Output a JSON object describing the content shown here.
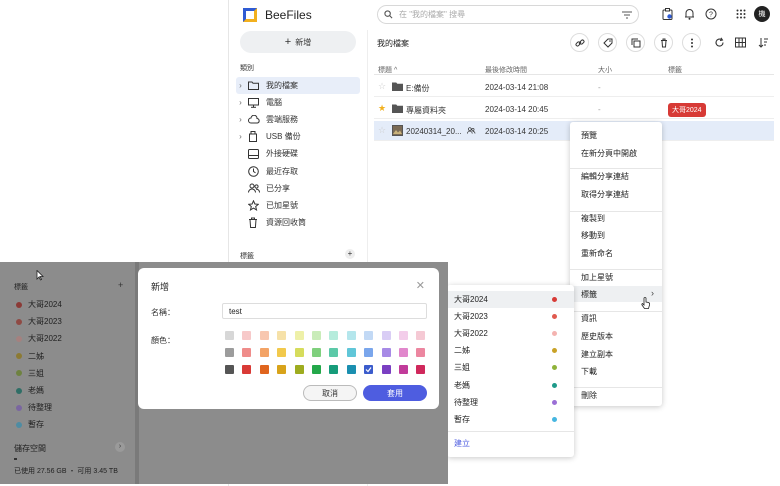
{
  "app": {
    "name": "BeeFiles",
    "search_placeholder": "在 \"我的檔案\" 搜尋",
    "avatar": "機",
    "new_button": "新增",
    "sidebar_heading": "類別",
    "sidebar": [
      {
        "label": "我的檔案",
        "icon": "folder-icon",
        "caret": true,
        "active": true
      },
      {
        "label": "電腦",
        "icon": "computer-icon",
        "caret": true,
        "active": false
      },
      {
        "label": "雲端服務",
        "icon": "cloud-icon",
        "caret": true,
        "active": false
      },
      {
        "label": "USB 備份",
        "icon": "usb-icon",
        "caret": true,
        "active": false
      },
      {
        "label": "外接硬碟",
        "icon": "drive-icon",
        "caret": false,
        "active": false
      },
      {
        "label": "最近存取",
        "icon": "clock-icon",
        "caret": false,
        "active": false
      },
      {
        "label": "已分享",
        "icon": "shared-icon",
        "caret": false,
        "active": false
      },
      {
        "label": "已加星號",
        "icon": "star-icon",
        "caret": false,
        "active": false
      },
      {
        "label": "資源回收筒",
        "icon": "trash-icon",
        "caret": false,
        "active": false
      }
    ],
    "tags_heading": "標籤",
    "main_title": "我的檔案",
    "columns": {
      "title": "標題 ^",
      "modified": "最後修改時間",
      "size": "大小",
      "tags": "標籤"
    },
    "files": [
      {
        "name": "E:備份",
        "modified": "2024-03-14 21:08",
        "size": "-",
        "starred": false,
        "type": "folder-icon",
        "tag": ""
      },
      {
        "name": "專屬資料夾",
        "modified": "2024-03-14 20:45",
        "size": "-",
        "starred": true,
        "type": "folder-icon",
        "tag": "大哥2024"
      },
      {
        "name": "20240314_20...",
        "modified": "2024-03-14 20:25",
        "size": "",
        "starred": false,
        "type": "image-icon",
        "tag": ""
      }
    ],
    "tag_color": "#d73a36"
  },
  "context_menu": {
    "items": [
      "預覽",
      "在新分頁中開啟",
      "編輯分享連結",
      "取得分享連結",
      "複製到",
      "移動到",
      "重新命名",
      "加上星號",
      "標籤",
      "資訊",
      "歷史版本",
      "建立副本",
      "下載",
      "刪除"
    ]
  },
  "tag_submenu": {
    "items": [
      {
        "label": "大哥2024",
        "color": "#d73a36"
      },
      {
        "label": "大哥2023",
        "color": "#e05a4f"
      },
      {
        "label": "大哥2022",
        "color": "#f4b3b0"
      },
      {
        "label": "二姊",
        "color": "#c9a227"
      },
      {
        "label": "三姐",
        "color": "#8fb33a"
      },
      {
        "label": "老媽",
        "color": "#1e9a8a"
      },
      {
        "label": "待整理",
        "color": "#9b6fd6"
      },
      {
        "label": "暫存",
        "color": "#46b6e0"
      }
    ],
    "create": "建立"
  },
  "bg_window": {
    "tags_heading": "標籤",
    "tags": [
      {
        "label": "大哥2024",
        "color": "#8b3a36"
      },
      {
        "label": "大哥2023",
        "color": "#8f4a44"
      },
      {
        "label": "大哥2022",
        "color": "#a5817f"
      },
      {
        "label": "二姊",
        "color": "#8c7a33"
      },
      {
        "label": "三姐",
        "color": "#6e8240"
      },
      {
        "label": "老媽",
        "color": "#2f6e66"
      },
      {
        "label": "待整理",
        "color": "#7a66a0"
      },
      {
        "label": "暫存",
        "color": "#4f8ca3"
      }
    ],
    "storage_heading": "儲存空間",
    "storage_text": "已使用 27.56 GB ・ 可用 3.45 TB"
  },
  "dialog": {
    "title": "新增",
    "name_label": "名稱：",
    "name_value": "test",
    "color_label": "顏色：",
    "cancel": "取消",
    "apply": "套用",
    "palette": [
      [
        "#d7d7d7",
        "#f7c9c9",
        "#f8c7b0",
        "#f6e1a8",
        "#eef0a8",
        "#c9ecb9",
        "#b6ecdc",
        "#b4e6ec",
        "#c2d9f5",
        "#d9cdf5",
        "#f3cdea",
        "#f5c9d4"
      ],
      [
        "#9c9c9c",
        "#ef8c8a",
        "#f3a366",
        "#f2c94c",
        "#d6dc5c",
        "#7fd07d",
        "#5cc9a8",
        "#60c6d8",
        "#7aa6ec",
        "#a78ae6",
        "#e187cc",
        "#ec86a0"
      ],
      [
        "#555555",
        "#d93a36",
        "#e0651e",
        "#d8a31a",
        "#9eac1f",
        "#24a84a",
        "#169c7a",
        "#1a8fb0",
        "#3b5ccc",
        "#7a3fc2",
        "#c13b9a",
        "#d0285c"
      ]
    ],
    "selected_swatch": "#3b5ccc"
  }
}
